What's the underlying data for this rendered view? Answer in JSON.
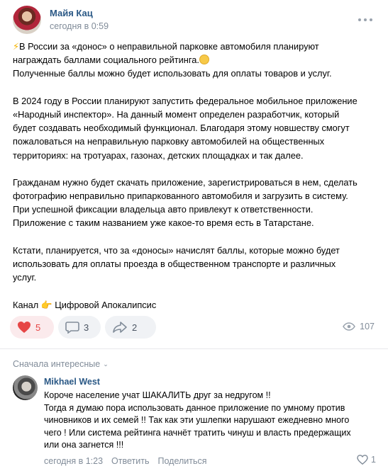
{
  "post": {
    "author": "Майя Кац",
    "time": "сегодня в 0:59",
    "lines": [
      "В России за «донос» о неправильной парковке автомобиля планируют",
      "награждать баллами социального рейтинга.",
      "Полученные баллы можно будет использовать для оплаты товаров и услуг.",
      "",
      "В 2024 году в России планируют запустить федеральное мобильное приложение",
      "«Народный инспектор». На данный момент определен разработчик, который",
      "будет создавать необходимый функционал. Благодаря этому новшеству смогут",
      "пожаловаться на неправильную парковку автомобилей на общественных",
      "территориях: на тротуарах, газонах, детских площадках и так далее.",
      "",
      "Гражданам нужно будет скачать приложение, зарегистрироваться в нем, сделать",
      "фотографию неправильно припаркованного автомобиля и загрузить в систему.",
      "При успешной фиксации владельца авто привлекут к ответственности.",
      "Приложение с таким названием уже какое-то время есть в Татарстане.",
      "",
      "Кстати, планируется, что за «доносы» начислят баллы, которые можно будет",
      "использовать для оплаты проезда в общественном транспорте и различных",
      "услуг.",
      "",
      "Канал",
      "Цифровой Апокалипсис"
    ],
    "icons": {
      "bolt": "lightning-emoji",
      "face": "flushed-face-emoji",
      "hand": "pointing-right-emoji"
    }
  },
  "actions": {
    "likes": "5",
    "comments": "3",
    "shares": "2",
    "views": "107"
  },
  "comments_section": {
    "sort_label": "Сначала интересные",
    "items": [
      {
        "author": "Mikhael West",
        "lines": [
          "Короче население учат ШАКАЛИТЬ друг за недругом !!",
          "Тогда я думаю пора использовать данное приложение по умному против",
          "чиновников и их семей !! Так как эти ушлепки нарушают ежедневно много",
          "чего ! Или система рейтинга начнёт тратить чинуш и власть предержащих",
          "или она загнется !!!"
        ],
        "time": "сегодня в 1:23",
        "reply_label": "Ответить",
        "share_label": "Поделиться",
        "likes": "1"
      }
    ]
  },
  "colors": {
    "link": "#2a5885",
    "muted": "#818c99",
    "like_active": "#e64646"
  }
}
